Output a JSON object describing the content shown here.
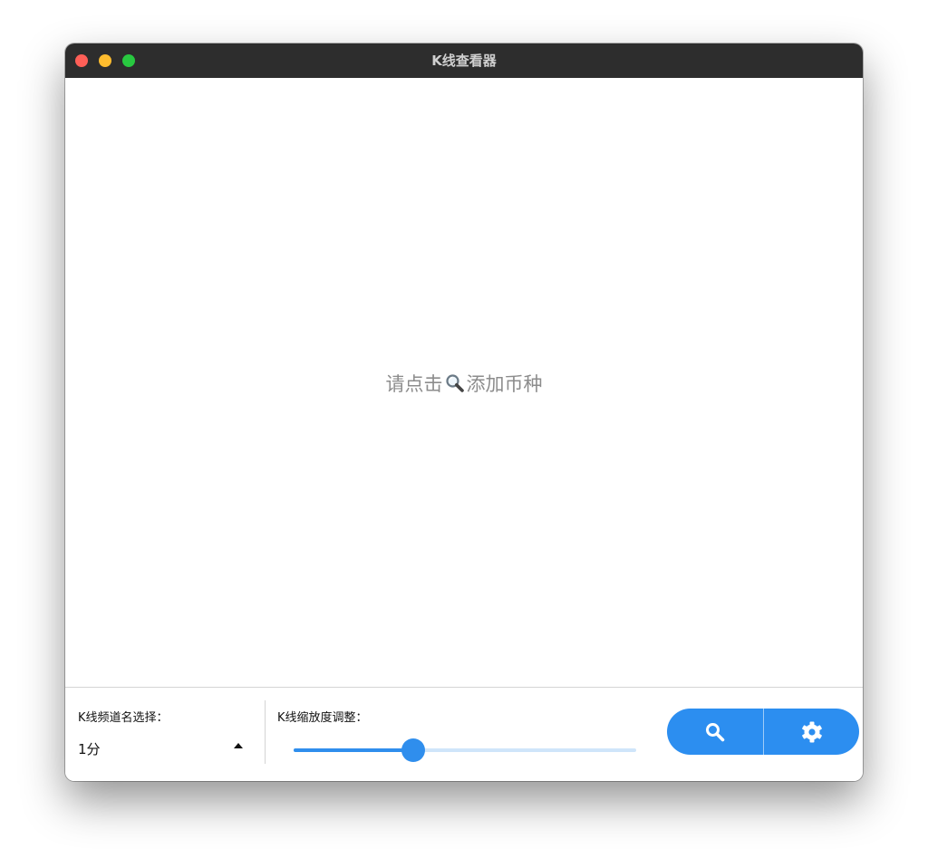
{
  "window": {
    "title": "K线查看器",
    "traffic_lights": {
      "close_color": "#ff5f57",
      "minimize_color": "#febc2e",
      "zoom_color": "#28c840"
    }
  },
  "main": {
    "placeholder_prefix": "请点击",
    "placeholder_icon": "magnifying-glass-icon",
    "placeholder_suffix": "添加币种"
  },
  "controls": {
    "frequency_label": "K线频道名选择：",
    "frequency_value": "1分",
    "zoom_label": "K线缩放度调整：",
    "zoom_fraction": 0.35,
    "search_button_icon": "search-icon",
    "settings_button_icon": "gear-icon",
    "accent_color": "#2c8ef0"
  }
}
